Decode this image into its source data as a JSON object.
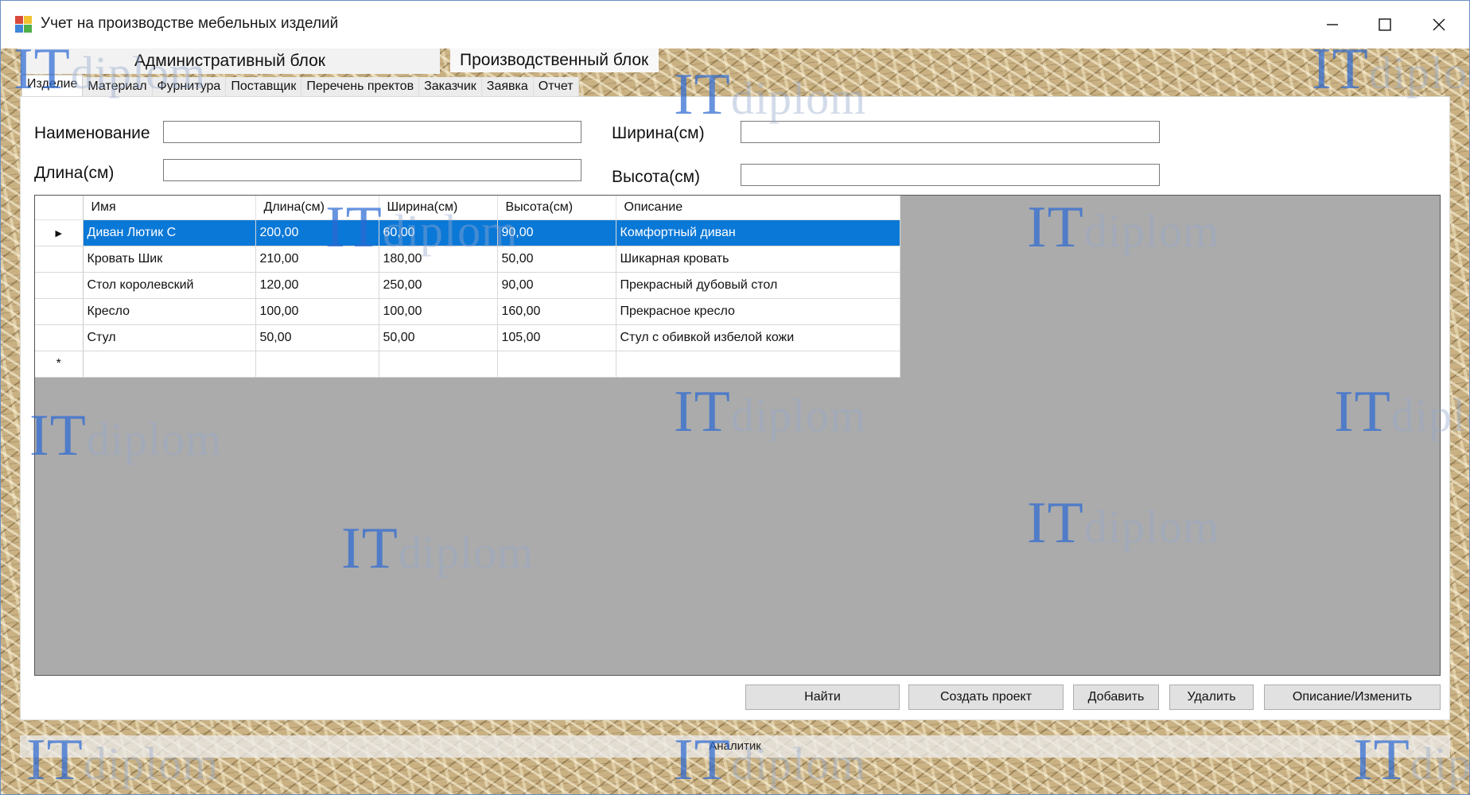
{
  "window": {
    "title": "Учет на производстве мебельных изделий",
    "minimize_glyph": "—",
    "maximize_glyph": "☐",
    "close_glyph": "✕",
    "app_icon": "app-icon"
  },
  "tab_groups": [
    "Административный блок",
    "Производственный блок"
  ],
  "tabs": [
    {
      "label": "Изделие",
      "active": true
    },
    {
      "label": "Материал",
      "active": false
    },
    {
      "label": "Фурнитура",
      "active": false
    },
    {
      "label": "Поставщик",
      "active": false
    },
    {
      "label": "Перечень пректов",
      "active": false
    },
    {
      "label": "Заказчик",
      "active": false
    },
    {
      "label": "Заявка",
      "active": false
    },
    {
      "label": "Отчет",
      "active": false
    }
  ],
  "form": {
    "name_label": "Наименование",
    "length_label": "Длина(см)",
    "width_label": "Ширина(см)",
    "height_label": "Высота(см)",
    "name_value": "",
    "length_value": "",
    "width_value": "",
    "height_value": ""
  },
  "grid": {
    "columns": [
      "Имя",
      "Длина(см)",
      "Ширина(см)",
      "Высота(см)",
      "Описание"
    ],
    "rows": [
      [
        "Диван Лютик С",
        "200,00",
        "60,00",
        "90,00",
        "Комфортный диван"
      ],
      [
        "Кровать Шик",
        "210,00",
        "180,00",
        "50,00",
        "Шикарная кровать"
      ],
      [
        "Стол королевский",
        "120,00",
        "250,00",
        "90,00",
        "Прекрасный дубовый стол"
      ],
      [
        "Кресло",
        "100,00",
        "100,00",
        "160,00",
        "Прекрасное кресло"
      ],
      [
        "Стул",
        "50,00",
        "50,00",
        "105,00",
        "Стул с обивкой избелой кожи"
      ]
    ],
    "selected_row_marker": "▶",
    "new_row_marker": "*",
    "selected_color": "#0a78d7",
    "background_color": "#ababab"
  },
  "buttons": {
    "find": "Найти",
    "create_project": "Создать проект",
    "add": "Добавить",
    "delete": "Удалить",
    "describe_edit": "Описание/Изменить"
  },
  "footer": {
    "analyst": "Аналитик"
  },
  "watermark": {
    "main": "IT",
    "sub": "diplom",
    "color": "#2d69d2"
  }
}
